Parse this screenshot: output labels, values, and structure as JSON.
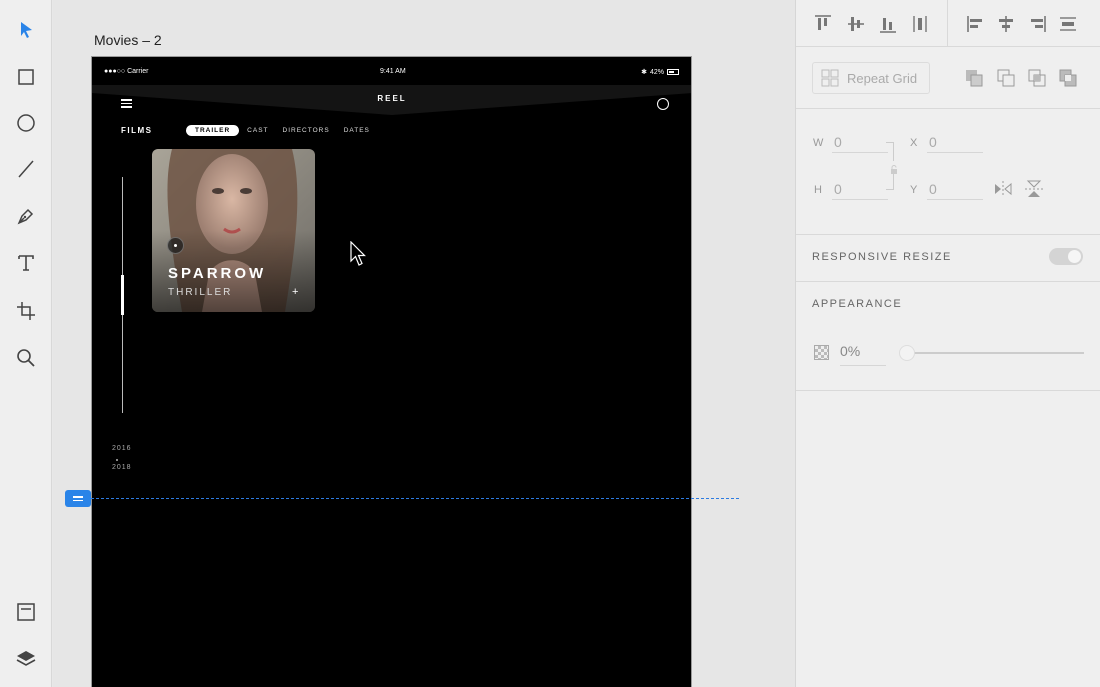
{
  "canvas": {
    "artboard_title": "Movies – 2"
  },
  "artboard": {
    "status_bar": {
      "carrier": "●●●○○ Carrier",
      "time": "9:41 AM",
      "battery": "42%"
    },
    "app_title": "REEL",
    "section_label": "FILMS",
    "tabs": [
      {
        "label": "TRAILER",
        "active": true
      },
      {
        "label": "CAST",
        "active": false
      },
      {
        "label": "DIRECTORS",
        "active": false
      },
      {
        "label": "DATES",
        "active": false
      }
    ],
    "timeline": {
      "year_start": "2016",
      "year_end": "2018"
    },
    "card": {
      "title": "SPARROW",
      "genre": "THRILLER",
      "add_symbol": "+"
    }
  },
  "panel": {
    "repeat_grid_label": "Repeat Grid",
    "fields": {
      "w_label": "W",
      "w_value": "0",
      "x_label": "X",
      "x_value": "0",
      "h_label": "H",
      "h_value": "0",
      "y_label": "Y",
      "y_value": "0"
    },
    "responsive_resize_label": "RESPONSIVE RESIZE",
    "appearance_label": "APPEARANCE",
    "opacity_value": "0%",
    "opacity_level": 0
  },
  "colors": {
    "accent": "#2a84e8",
    "artboard_bg": "#000000",
    "panel_bg": "#efefef"
  }
}
